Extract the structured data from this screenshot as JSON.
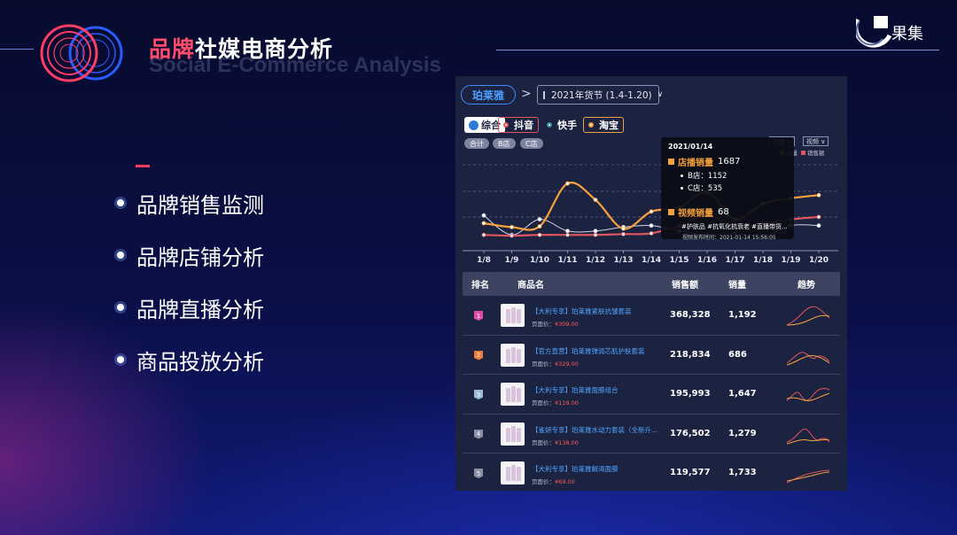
{
  "header": {
    "title_red": "品牌",
    "title_white": "社媒电商分析",
    "subtitle_en": "Social E-Commerce Analysis",
    "logo_text": "果集"
  },
  "menu": {
    "items": [
      {
        "label": "品牌销售监测"
      },
      {
        "label": "品牌店铺分析"
      },
      {
        "label": "品牌直播分析"
      },
      {
        "label": "商品投放分析"
      }
    ]
  },
  "panel": {
    "brand": "珀莱雅",
    "breadcrumb_sep": ">",
    "date_range": "2021年货节 (1.4-1.20)",
    "platform_tabs": [
      {
        "label": "综合"
      },
      {
        "label": "抖音"
      },
      {
        "label": "快手"
      },
      {
        "label": "淘宝"
      }
    ],
    "store_filters": [
      {
        "label": "合计"
      },
      {
        "label": "B店"
      },
      {
        "label": "C店"
      }
    ],
    "chart_selects": [
      {
        "label": "店播"
      },
      {
        "label": "视频"
      }
    ],
    "chart_legend": [
      {
        "label": "销量"
      },
      {
        "label": "销售额"
      }
    ],
    "tooltip": {
      "date": "2021/01/14",
      "store_label": "店播销量",
      "store_value": "1687",
      "b_store": "B店：1152",
      "c_store": "C店：535",
      "video_label": "视频销量",
      "video_value": "68",
      "tags": "#护肤品 #抗氧化抗衰老 #直播带货...",
      "publish_time": "视频发布时间：2021-01-14 15:56:05"
    },
    "colors": {
      "orange": "#f5a23d",
      "red": "#e0555e",
      "blue": "#3b8cff"
    },
    "table": {
      "headers": {
        "rank": "排名",
        "product": "商品名",
        "sales": "销售额",
        "qty": "销量",
        "trend": "趋势"
      },
      "price_label": "页面价：",
      "rows": [
        {
          "rank": "1",
          "name": "【大利专享】珀莱雅紧肤抗皱套装",
          "price": "¥309.00",
          "sales": "368,328",
          "qty": "1,192",
          "rank_color": "#e04ba8"
        },
        {
          "rank": "2",
          "name": "【官方直营】珀莱雅弹润芯肌护肤套装",
          "price": "¥329.00",
          "sales": "218,834",
          "qty": "686",
          "rank_color": "#f07a3a"
        },
        {
          "rank": "3",
          "name": "【大利专享】珀莱雅面膜组合",
          "price": "¥119.00",
          "sales": "195,993",
          "qty": "1,647",
          "rank_color": "#9bb8d8"
        },
        {
          "rank": "4",
          "name": "【雀妍专享】珀莱雅水动力套装（全新升...",
          "price": "¥138.00",
          "sales": "176,502",
          "qty": "1,279",
          "rank_color": "#8a90a6"
        },
        {
          "rank": "5",
          "name": "【大利专享】珀莱雅解渴面膜",
          "price": "¥69.00",
          "sales": "119,577",
          "qty": "1,733",
          "rank_color": "#8a90a6"
        }
      ]
    }
  },
  "chart_data": {
    "type": "line",
    "categories": [
      "1/8",
      "1/9",
      "1/10",
      "1/11",
      "1/12",
      "1/13",
      "1/14",
      "1/15",
      "1/16",
      "1/17",
      "1/18",
      "1/19",
      "1/20"
    ],
    "series": [
      {
        "name": "销量",
        "color": "#f5a23d",
        "values": [
          25,
          20,
          21,
          76,
          55,
          18,
          40,
          45,
          65,
          30,
          50,
          57,
          61
        ]
      },
      {
        "name": "销售额",
        "color": "#e0555e",
        "values": [
          10,
          9,
          10,
          10,
          10,
          11,
          12,
          22,
          35,
          20,
          25,
          30,
          33
        ]
      },
      {
        "name": "",
        "color": "#d0d4e6",
        "values": [
          35,
          10,
          30,
          15,
          15,
          20,
          22,
          15,
          10,
          12,
          8,
          22,
          22
        ]
      }
    ],
    "ylim": [
      0,
      100
    ],
    "grid": true
  }
}
